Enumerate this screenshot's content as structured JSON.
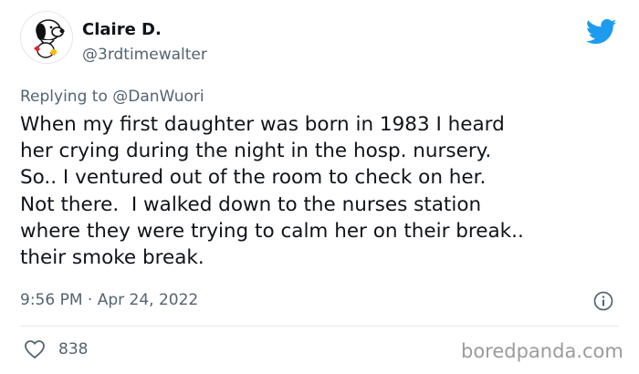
{
  "author": {
    "display_name": "Claire D.",
    "handle": "@3rdtimewalter",
    "avatar_icon": "snoopy-avatar-icon"
  },
  "brand_icon": "twitter-bird-icon",
  "reply": {
    "prefix": "Replying to",
    "handle": "@DanWuori"
  },
  "tweet": {
    "lines": [
      "When my first daughter was born in 1983 I heard",
      "her crying during the night in the hosp. nursery.",
      "So.. I ventured out of the room to check on her.",
      "Not there.  I walked down to the nurses station",
      "where they were trying to calm her on their break..",
      "their smoke break."
    ]
  },
  "meta": {
    "timestamp": "9:56 PM · Apr 24, 2022",
    "likes": "838"
  },
  "watermark": "boredpanda.com",
  "colors": {
    "twitter_blue": "#1d9bf0",
    "text": "#0f1419",
    "secondary": "#536471"
  }
}
